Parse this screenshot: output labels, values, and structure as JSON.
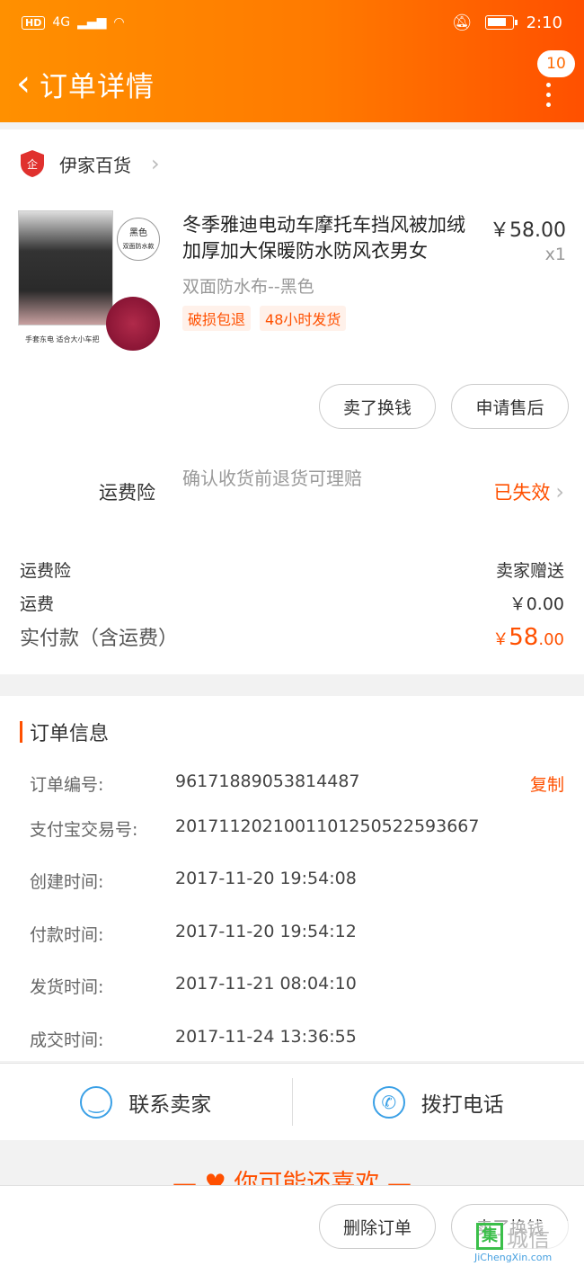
{
  "status_bar": {
    "left": "HD",
    "network": "4G",
    "time": "2:10"
  },
  "header": {
    "title": "订单详情",
    "badge_count": "10"
  },
  "shop": {
    "name": "伊家百货"
  },
  "product": {
    "title": "冬季雅迪电动车摩托车挡风被加绒加厚加大保暖防水防风衣男女",
    "price": "￥58.00",
    "qty": "x1",
    "spec": "双面防水布--黑色",
    "tags": [
      "破损包退",
      "48小时发货"
    ],
    "thumb_badge_line1": "黑色",
    "thumb_badge_line2": "双面防水款",
    "thumb_caption": "手套东电 适合大小车把"
  },
  "item_actions": {
    "sell_label": "卖了换钱",
    "after_sale_label": "申请售后"
  },
  "insurance": {
    "label": "运费险",
    "desc": "确认收货前退货可理赔",
    "status": "已失效"
  },
  "fees": [
    {
      "key": "运费险",
      "value": "卖家赠送"
    },
    {
      "key": "运费",
      "value": "￥0.00"
    }
  ],
  "total": {
    "label": "实付款（含运费）",
    "currency": "￥",
    "integer": "58",
    "decimal": ".00"
  },
  "order_info": {
    "title": "订单信息",
    "copy_label": "复制",
    "rows": [
      {
        "key": "订单编号:",
        "value": "96171889053814487"
      },
      {
        "key": "支付宝交易号:",
        "value": "2017112021001101250522593667"
      },
      {
        "key": "创建时间:",
        "value": "2017-11-20 19:54:08"
      },
      {
        "key": "付款时间:",
        "value": "2017-11-20 19:54:12"
      },
      {
        "key": "发货时间:",
        "value": "2017-11-21 08:04:10"
      },
      {
        "key": "成交时间:",
        "value": "2017-11-24 13:36:55"
      }
    ]
  },
  "contact": {
    "seller_label": "联系卖家",
    "phone_label": "拨打电话"
  },
  "recommend": {
    "title": "你可能还喜欢"
  },
  "bottom_bar": {
    "delete_label": "删除订单",
    "sell_label": "卖了换钱"
  },
  "watermark": {
    "text": "城信",
    "url": "JiChengXin.com"
  },
  "colors": {
    "brand_orange": "#ff5000",
    "header_start": "#ff9000",
    "contact_blue": "#3aa0e6"
  }
}
